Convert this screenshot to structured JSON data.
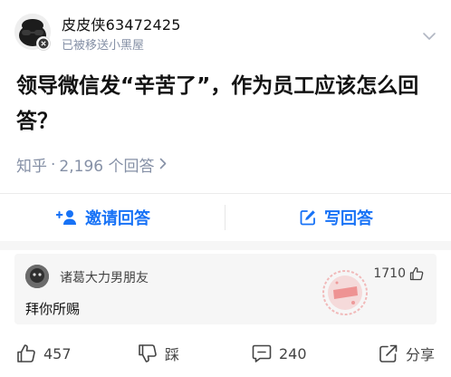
{
  "author": {
    "name": "皮皮侠63472425",
    "status": "已被移送小黑屋"
  },
  "question": {
    "title": "领导微信发“辛苦了”，作为员工应该怎么回答？"
  },
  "meta": {
    "source": "知乎",
    "dot": "·",
    "answer_count": "2,196 个回答"
  },
  "actions": {
    "invite_label": "邀请回答",
    "write_label": "写回答"
  },
  "comment": {
    "user": "诸葛大力男朋友",
    "text": "拜你所赐",
    "likes": "1710"
  },
  "bottom_bar": {
    "likes": "457",
    "dislike_label": "踩",
    "comments": "240",
    "share_label": "分享"
  },
  "colors": {
    "accent": "#1772f6",
    "meta_gray": "#8590a6",
    "stamp_red": "#e85a5a"
  }
}
